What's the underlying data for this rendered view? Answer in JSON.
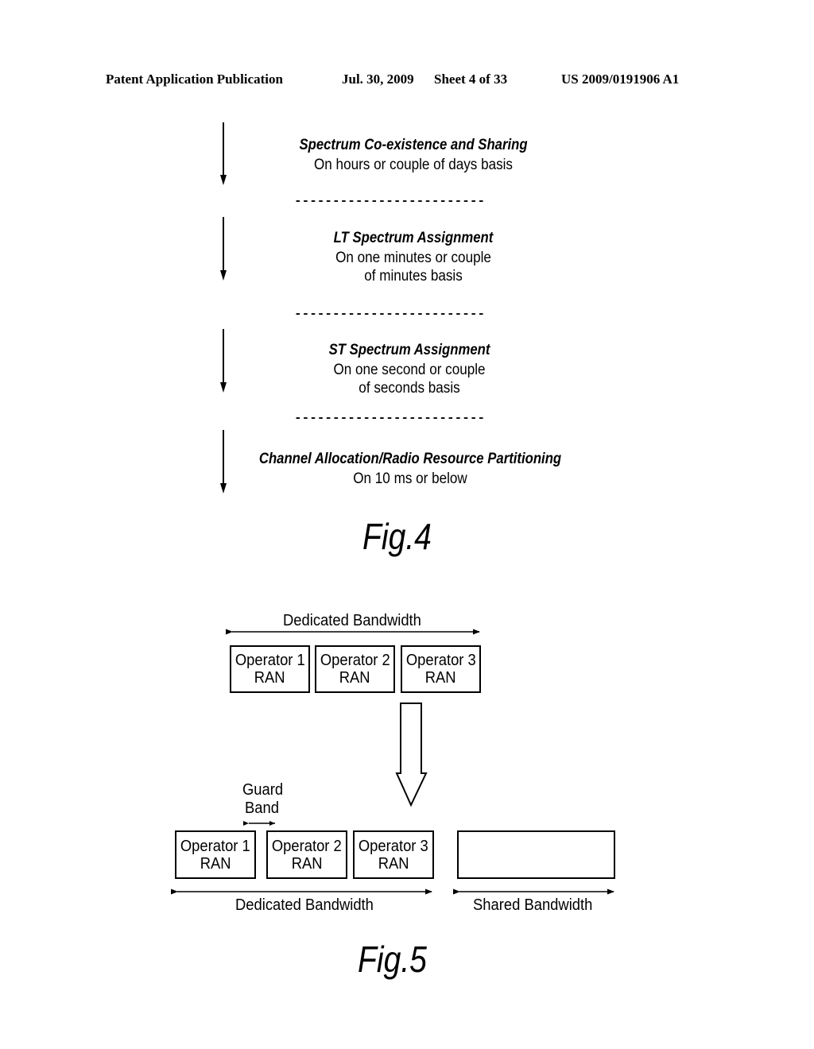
{
  "header": {
    "publication": "Patent Application Publication",
    "date": "Jul. 30, 2009",
    "sheet": "Sheet 4 of 33",
    "number": "US 2009/0191906 A1"
  },
  "fig4": {
    "label": "Fig.4",
    "separator": "-------------------------",
    "levels": [
      {
        "title": "Spectrum Co-existence and Sharing",
        "lines": [
          "On hours or couple of days basis"
        ]
      },
      {
        "title": "LT Spectrum Assignment",
        "lines": [
          "On one minutes or couple",
          "of minutes basis"
        ]
      },
      {
        "title": "ST Spectrum Assignment",
        "lines": [
          "On one second or couple",
          "of seconds basis"
        ]
      },
      {
        "title": "Channel Allocation/Radio Resource Partitioning",
        "lines": [
          "On 10 ms or below"
        ]
      }
    ]
  },
  "fig5": {
    "label": "Fig.5",
    "top": {
      "bandwidth_label": "Dedicated Bandwidth",
      "boxes": [
        {
          "line1": "Operator 1",
          "line2": "RAN"
        },
        {
          "line1": "Operator 2",
          "line2": "RAN"
        },
        {
          "line1": "Operator 3",
          "line2": "RAN"
        }
      ]
    },
    "bottom": {
      "guard_band_label_1": "Guard",
      "guard_band_label_2": "Band",
      "boxes": [
        {
          "line1": "Operator 1",
          "line2": "RAN"
        },
        {
          "line1": "Operator 2",
          "line2": "RAN"
        },
        {
          "line1": "Operator 3",
          "line2": "RAN"
        }
      ],
      "dedicated_label": "Dedicated Bandwidth",
      "shared_label": "Shared Bandwidth"
    }
  }
}
